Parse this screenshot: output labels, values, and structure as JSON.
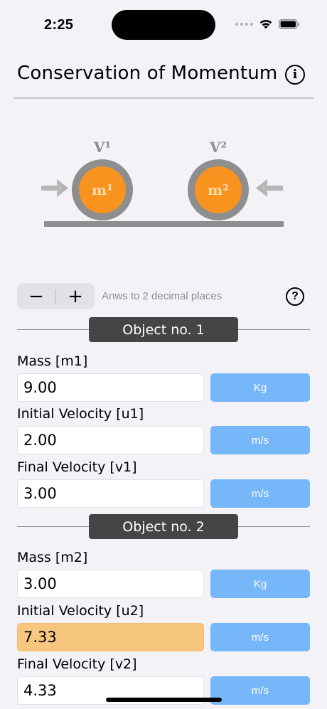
{
  "status_bar": {
    "time": "2:25"
  },
  "nav": {
    "title": "Conservation of Momentum",
    "info_glyph": "i"
  },
  "diagram": {
    "v1_label": "V¹",
    "v2_label": "V²",
    "m1_label": "m¹",
    "m2_label": "m²",
    "colors": {
      "ball_fill": "#f7931e",
      "ball_ring": "#8e8e8e",
      "arrow": "#b5b5b5",
      "ground": "#8e8e8e"
    }
  },
  "stepper": {
    "minus": "−",
    "plus": "+"
  },
  "precision_label": "Anws to 2 decimal places",
  "help_glyph": "?",
  "object1": {
    "header": "Object no. 1",
    "mass_label": "Mass [m1]",
    "mass_value": "9.00",
    "mass_unit": "Kg",
    "u_label": "Initial Velocity [u1]",
    "u_value": "2.00",
    "u_unit": "m/s",
    "v_label": "Final Velocity [v1]",
    "v_value": "3.00",
    "v_unit": "m/s"
  },
  "object2": {
    "header": "Object no. 2",
    "mass_label": "Mass [m2]",
    "mass_value": "3.00",
    "mass_unit": "Kg",
    "u_label": "Initial Velocity [u2]",
    "u_value": "7.33",
    "u_unit": "m/s",
    "v_label": "Final Velocity [v2]",
    "v_value": "4.33",
    "v_unit": "m/s"
  },
  "colors": {
    "unit_button": "#75b7f9",
    "result_highlight": "#f8c77f",
    "section_header": "#454545"
  }
}
